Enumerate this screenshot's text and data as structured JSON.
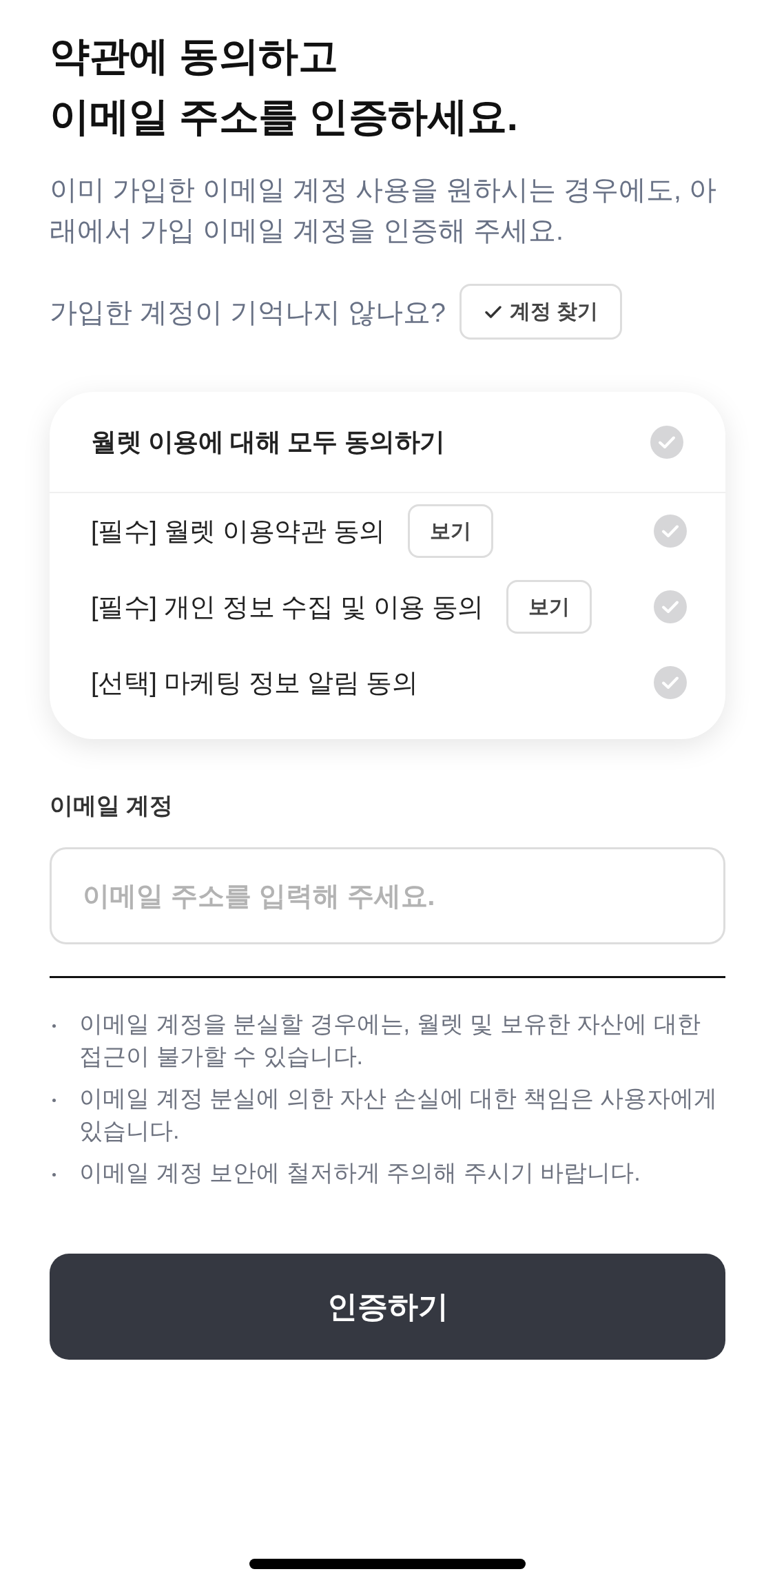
{
  "title": "약관에 동의하고\n이메일 주소를 인증하세요.",
  "description": "이미 가입한 이메일 계정 사용을 원하시는 경우에도, 아래에서 가입 이메일 계정을 인증해 주세요.",
  "find_account": {
    "prompt": "가입한 계정이 기억나지 않나요?",
    "button": "계정 찾기"
  },
  "agreement": {
    "all": {
      "label": "월렛 이용에 대해 모두 동의하기",
      "checked": false
    },
    "items": [
      {
        "label": "[필수] 월렛 이용약관 동의",
        "view_button": "보기",
        "checked": false
      },
      {
        "label": "[필수] 개인 정보 수집 및 이용 동의",
        "view_button": "보기",
        "checked": false
      },
      {
        "label": "[선택] 마케팅 정보 알림 동의",
        "checked": false
      }
    ]
  },
  "email": {
    "label": "이메일 계정",
    "placeholder": "이메일 주소를 입력해 주세요."
  },
  "notes": [
    "이메일 계정을 분실할 경우에는, 월렛 및 보유한 자산에 대한 접근이 불가할 수 있습니다.",
    "이메일 계정 분실에 의한 자산 손실에 대한 책임은 사용자에게 있습니다.",
    "이메일 계정 보안에 철저하게 주의해 주시기 바랍니다."
  ],
  "submit_button": "인증하기"
}
